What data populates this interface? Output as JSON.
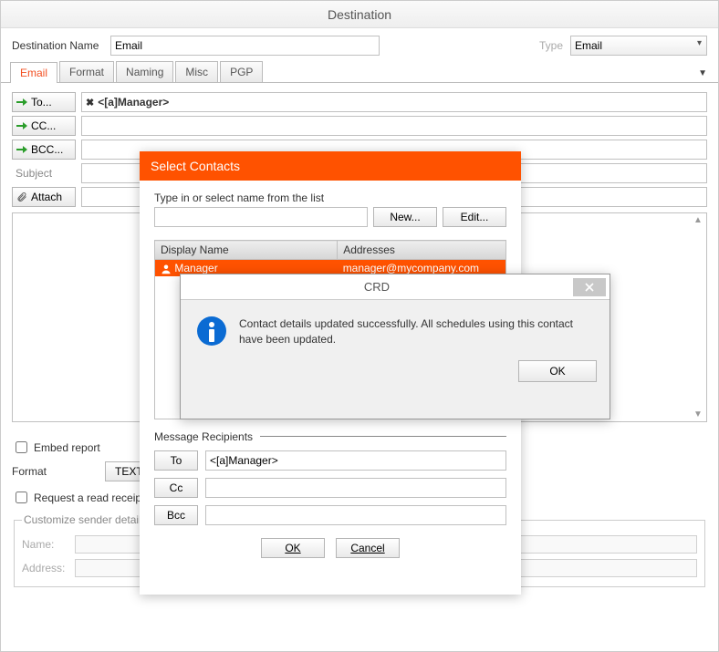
{
  "window": {
    "title": "Destination"
  },
  "form": {
    "dest_label": "Destination Name",
    "dest_value": "Email",
    "type_label": "Type",
    "type_value": "Email"
  },
  "tabs": {
    "items": [
      "Email",
      "Format",
      "Naming",
      "Misc",
      "PGP"
    ],
    "active": 0
  },
  "email": {
    "to_btn": "To...",
    "cc_btn": "CC...",
    "bcc_btn": "BCC...",
    "subject_label": "Subject",
    "attach_btn": "Attach",
    "to_value": "<[a]Manager>",
    "cc_value": "",
    "bcc_value": "",
    "subject_value": ""
  },
  "options": {
    "embed_label": "Embed report",
    "format_label": "Format",
    "format_btn": "TEXT",
    "read_receipt_label": "Request a read receipt"
  },
  "sender": {
    "legend": "Customize sender details",
    "name_label": "Name:",
    "address_label": "Address:",
    "name_value": "",
    "address_value": ""
  },
  "contacts_dialog": {
    "title": "Select Contacts",
    "hint": "Type in or select name from the list",
    "new_btn": "New...",
    "edit_btn": "Edit...",
    "search_value": "",
    "columns": {
      "name": "Display Name",
      "addr": "Addresses"
    },
    "rows": [
      {
        "name": "Manager",
        "addr": "manager@mycompany.com"
      }
    ],
    "recipients_label": "Message Recipients",
    "to_btn": "To",
    "cc_btn": "Cc",
    "bcc_btn": "Bcc",
    "to_value": "<[a]Manager>",
    "cc_value": "",
    "bcc_value": "",
    "ok_btn": "OK",
    "cancel_btn": "Cancel"
  },
  "msg_dialog": {
    "title": "CRD",
    "text": "Contact details updated successfully. All schedules using this contact have been updated.",
    "ok_btn": "OK"
  }
}
